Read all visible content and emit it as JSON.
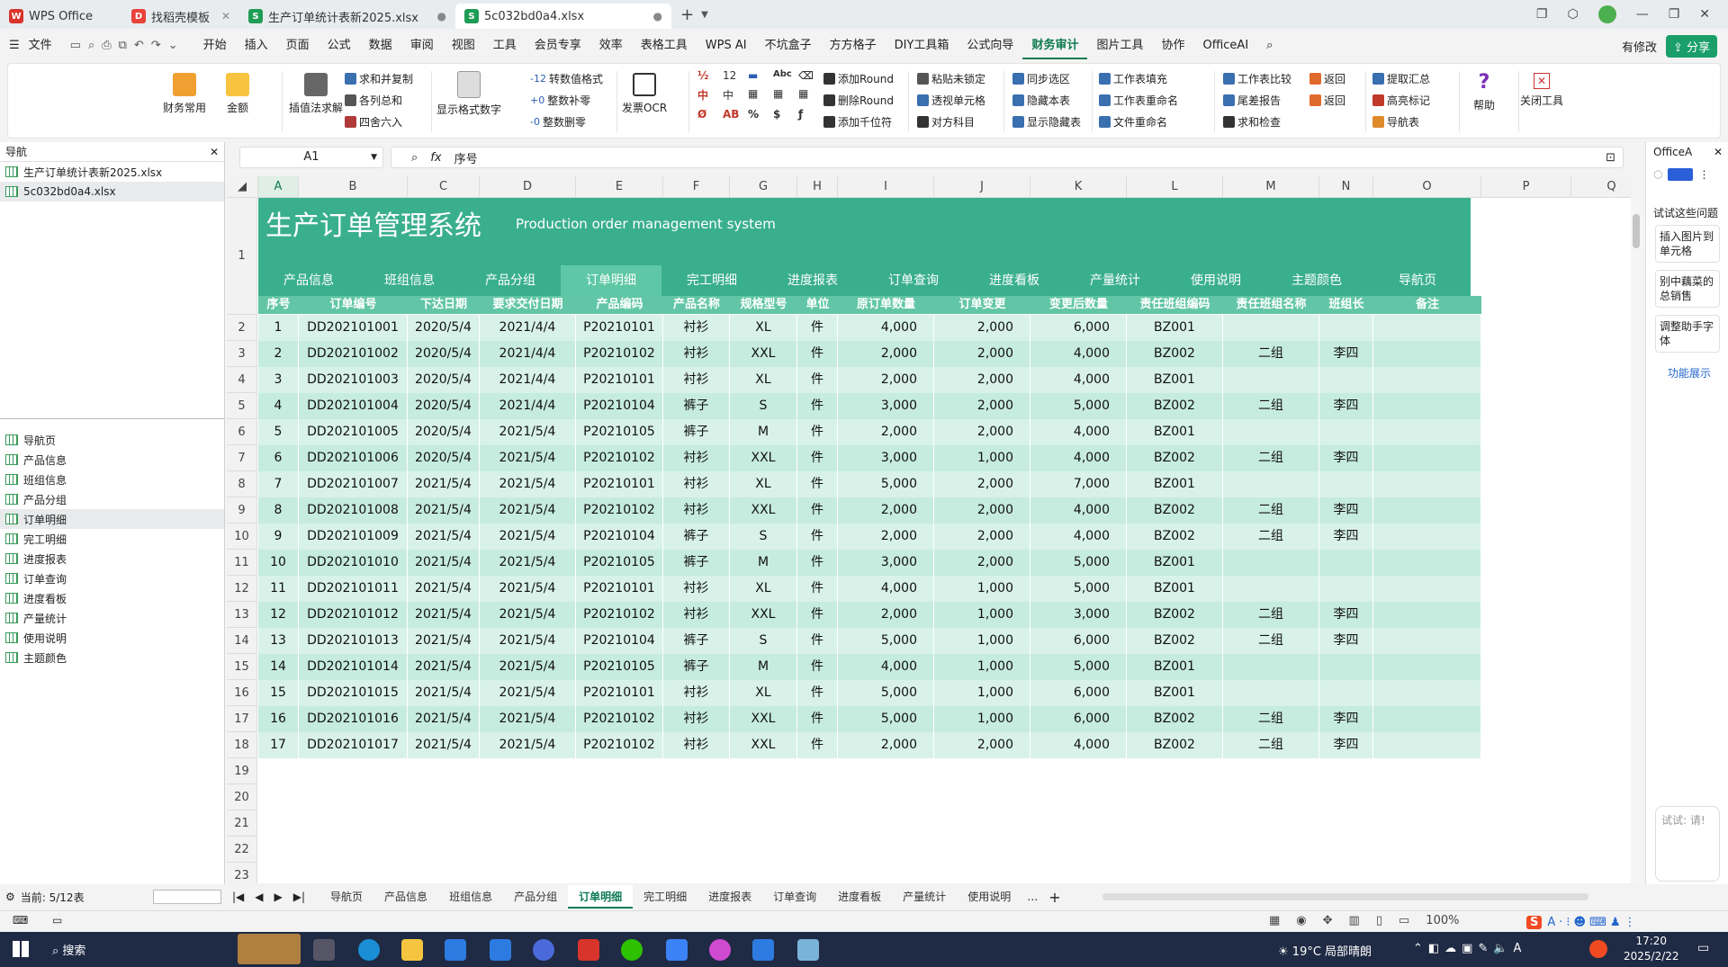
{
  "titlebar": {
    "tabs": [
      "WPS Office",
      "找稻壳模板",
      "生产订单统计表新2025.xlsx",
      "5c032bd0a4.xlsx"
    ],
    "new_tab": "+"
  },
  "menubar": {
    "file": "文件",
    "items": [
      "开始",
      "插入",
      "页面",
      "公式",
      "数据",
      "审阅",
      "视图",
      "工具",
      "会员专享",
      "效率",
      "表格工具",
      "WPS AI",
      "不坑盒子",
      "方方格子",
      "DIY工具箱",
      "公式向导",
      "财务审计",
      "图片工具",
      "协作",
      "OfficeAI"
    ],
    "active": "财务审计",
    "has_changes": "有修改",
    "share": "分享"
  },
  "ribbon": {
    "big": [
      "财务常用",
      "金额",
      "插值法求解",
      "显示格式数字",
      "发票OCR",
      "帮助",
      "关闭工具"
    ],
    "col1": [
      "求和并复制",
      "各列总和",
      "四舍六入"
    ],
    "col2": [
      "转数值格式",
      "整数补零",
      "整数删零"
    ],
    "col2_prefix": [
      "-12",
      "+0",
      "-0"
    ],
    "col3": [
      "添加Round",
      "删除Round",
      "添加千位符"
    ],
    "col4": [
      "粘贴未锁定",
      "透视单元格",
      "对方科目"
    ],
    "col5": [
      "同步选区",
      "隐藏本表",
      "显示隐藏表"
    ],
    "col6": [
      "工作表填充",
      "工作表重命名",
      "文件重命名"
    ],
    "col7": [
      "工作表比较",
      "尾差报告",
      "求和检查"
    ],
    "col7b": [
      "返回",
      "返回"
    ],
    "col8": [
      "提取汇总",
      "高亮标记",
      "导航表"
    ],
    "num_icons": [
      "12"
    ]
  },
  "navpane": {
    "title": "导航",
    "files": [
      "生产订单统计表新2025.xlsx",
      "5c032bd0a4.xlsx"
    ],
    "sheets": [
      "导航页",
      "产品信息",
      "班组信息",
      "产品分组",
      "订单明细",
      "完工明细",
      "进度报表",
      "订单查询",
      "进度看板",
      "产量统计",
      "使用说明",
      "主题颜色"
    ],
    "selected_sheet": "订单明细",
    "current": "当前: 5/12表"
  },
  "formulabar": {
    "cell_ref": "A1",
    "fx": "fx",
    "content": "序号"
  },
  "grid": {
    "columns": [
      "A",
      "B",
      "C",
      "D",
      "E",
      "F",
      "G",
      "H",
      "I",
      "J",
      "K",
      "L",
      "M",
      "N",
      "O",
      "P",
      "Q"
    ],
    "rows": [
      "1",
      "2",
      "3",
      "4",
      "5",
      "6",
      "7",
      "8",
      "9",
      "10",
      "11",
      "12",
      "13",
      "14",
      "15",
      "16",
      "17",
      "18",
      "19",
      "20",
      "21",
      "22",
      "23"
    ],
    "banner_title": "生产订单管理系统",
    "banner_subtitle": "Production order management system",
    "banner_nav": [
      "产品信息",
      "班组信息",
      "产品分组",
      "订单明细",
      "完工明细",
      "进度报表",
      "订单查询",
      "进度看板",
      "产量统计",
      "使用说明",
      "主题颜色",
      "导航页"
    ],
    "active_nav": "订单明细",
    "headers": [
      "序号",
      "订单编号",
      "下达日期",
      "要求交付日期",
      "产品编码",
      "产品名称",
      "规格型号",
      "单位",
      "原订单数量",
      "订单变更",
      "变更后数量",
      "责任班组编码",
      "责任班组名称",
      "班组长",
      "备注"
    ],
    "data": [
      [
        "1",
        "DD202101001",
        "2020/5/4",
        "2021/4/4",
        "P20210101",
        "衬衫",
        "XL",
        "件",
        "4,000",
        "2,000",
        "6,000",
        "BZ001",
        "",
        "",
        ""
      ],
      [
        "2",
        "DD202101002",
        "2020/5/4",
        "2021/4/4",
        "P20210102",
        "衬衫",
        "XXL",
        "件",
        "2,000",
        "2,000",
        "4,000",
        "BZ002",
        "二组",
        "李四",
        ""
      ],
      [
        "3",
        "DD202101003",
        "2020/5/4",
        "2021/4/4",
        "P20210101",
        "衬衫",
        "XL",
        "件",
        "2,000",
        "2,000",
        "4,000",
        "BZ001",
        "",
        "",
        ""
      ],
      [
        "4",
        "DD202101004",
        "2020/5/4",
        "2021/4/4",
        "P20210104",
        "裤子",
        "S",
        "件",
        "3,000",
        "2,000",
        "5,000",
        "BZ002",
        "二组",
        "李四",
        ""
      ],
      [
        "5",
        "DD202101005",
        "2020/5/4",
        "2021/5/4",
        "P20210105",
        "裤子",
        "M",
        "件",
        "2,000",
        "2,000",
        "4,000",
        "BZ001",
        "",
        "",
        ""
      ],
      [
        "6",
        "DD202101006",
        "2020/5/4",
        "2021/5/4",
        "P20210102",
        "衬衫",
        "XXL",
        "件",
        "3,000",
        "1,000",
        "4,000",
        "BZ002",
        "二组",
        "李四",
        ""
      ],
      [
        "7",
        "DD202101007",
        "2021/5/4",
        "2021/5/4",
        "P20210101",
        "衬衫",
        "XL",
        "件",
        "5,000",
        "2,000",
        "7,000",
        "BZ001",
        "",
        "",
        ""
      ],
      [
        "8",
        "DD202101008",
        "2021/5/4",
        "2021/5/4",
        "P20210102",
        "衬衫",
        "XXL",
        "件",
        "2,000",
        "2,000",
        "4,000",
        "BZ002",
        "二组",
        "李四",
        ""
      ],
      [
        "9",
        "DD202101009",
        "2021/5/4",
        "2021/5/4",
        "P20210104",
        "裤子",
        "S",
        "件",
        "2,000",
        "2,000",
        "4,000",
        "BZ002",
        "二组",
        "李四",
        ""
      ],
      [
        "10",
        "DD202101010",
        "2021/5/4",
        "2021/5/4",
        "P20210105",
        "裤子",
        "M",
        "件",
        "3,000",
        "2,000",
        "5,000",
        "BZ001",
        "",
        "",
        ""
      ],
      [
        "11",
        "DD202101011",
        "2021/5/4",
        "2021/5/4",
        "P20210101",
        "衬衫",
        "XL",
        "件",
        "4,000",
        "1,000",
        "5,000",
        "BZ001",
        "",
        "",
        ""
      ],
      [
        "12",
        "DD202101012",
        "2021/5/4",
        "2021/5/4",
        "P20210102",
        "衬衫",
        "XXL",
        "件",
        "2,000",
        "1,000",
        "3,000",
        "BZ002",
        "二组",
        "李四",
        ""
      ],
      [
        "13",
        "DD202101013",
        "2021/5/4",
        "2021/5/4",
        "P20210104",
        "裤子",
        "S",
        "件",
        "5,000",
        "1,000",
        "6,000",
        "BZ002",
        "二组",
        "李四",
        ""
      ],
      [
        "14",
        "DD202101014",
        "2021/5/4",
        "2021/5/4",
        "P20210105",
        "裤子",
        "M",
        "件",
        "4,000",
        "1,000",
        "5,000",
        "BZ001",
        "",
        "",
        ""
      ],
      [
        "15",
        "DD202101015",
        "2021/5/4",
        "2021/5/4",
        "P20210101",
        "衬衫",
        "XL",
        "件",
        "5,000",
        "1,000",
        "6,000",
        "BZ001",
        "",
        "",
        ""
      ],
      [
        "16",
        "DD202101016",
        "2021/5/4",
        "2021/5/4",
        "P20210102",
        "衬衫",
        "XXL",
        "件",
        "5,000",
        "1,000",
        "6,000",
        "BZ002",
        "二组",
        "李四",
        ""
      ],
      [
        "17",
        "DD202101017",
        "2021/5/4",
        "2021/5/4",
        "P20210102",
        "衬衫",
        "XXL",
        "件",
        "2,000",
        "2,000",
        "4,000",
        "BZ002",
        "二组",
        "李四",
        ""
      ]
    ]
  },
  "sheettabs": {
    "tabs": [
      "导航页",
      "产品信息",
      "班组信息",
      "产品分组",
      "订单明细",
      "完工明细",
      "进度报表",
      "订单查询",
      "进度看板",
      "产量统计",
      "使用说明"
    ],
    "active": "订单明细",
    "more": "…",
    "add": "+"
  },
  "statusbar": {
    "zoom": "100%"
  },
  "rightpane": {
    "title": "OfficeA",
    "hint": "试试这些问题",
    "cards": [
      "插入图片到单元格",
      "别中藕菜的总销售",
      "调整助手字体"
    ],
    "feature": "功能展示",
    "input_hint": "试试: 请!"
  },
  "taskbar": {
    "search": "搜索",
    "weather": "19°C 局部晴朗",
    "time": "17:20",
    "date": "2025/2/22"
  },
  "colors": {
    "banner": "#3aaf8e",
    "header": "#62c6a6",
    "row_even": "#d8f2e9",
    "row_odd": "#c6ebdf",
    "accent": "#0e7a52"
  }
}
